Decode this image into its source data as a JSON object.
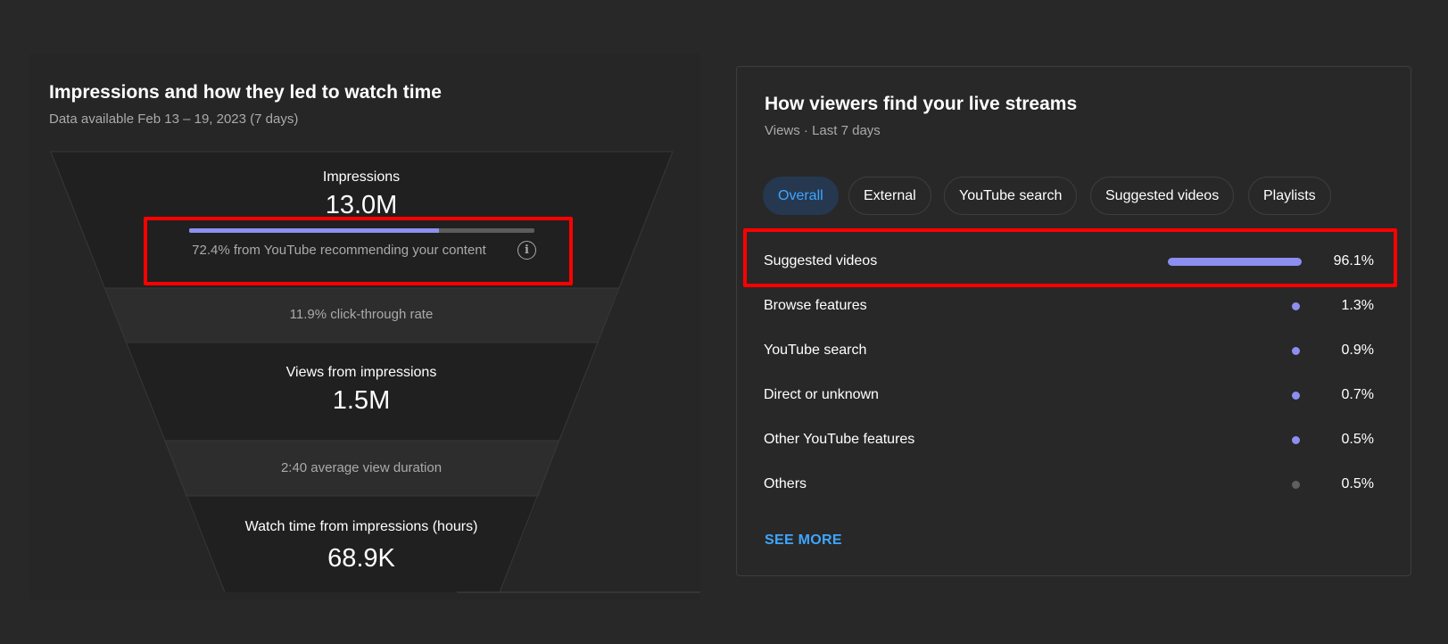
{
  "funnel_card": {
    "title": "Impressions and how they led to watch time",
    "subtitle": "Data available Feb 13 – 19, 2023 (7 days)",
    "impressions": {
      "label": "Impressions",
      "value": "13.0M",
      "recommend_text": "72.4% from YouTube recommending your content",
      "recommend_fraction": 0.724
    },
    "ctr_text": "11.9% click-through rate",
    "views": {
      "label": "Views from impressions",
      "value": "1.5M"
    },
    "avd_text": "2:40 average view duration",
    "watch_time": {
      "label": "Watch time from impressions (hours)",
      "value": "68.9K"
    }
  },
  "traffic_card": {
    "title": "How viewers find your live streams",
    "subtitle": "Views · Last 7 days",
    "chips": [
      {
        "label": "Overall",
        "active": true
      },
      {
        "label": "External",
        "active": false
      },
      {
        "label": "YouTube search",
        "active": false
      },
      {
        "label": "Suggested videos",
        "active": false
      },
      {
        "label": "Playlists",
        "active": false
      }
    ],
    "rows": [
      {
        "label": "Suggested videos",
        "value": "96.1%",
        "share": 0.961,
        "color": "#8c8ff0"
      },
      {
        "label": "Browse features",
        "value": "1.3%",
        "share": 0.013,
        "color": "#8c8ff0"
      },
      {
        "label": "YouTube search",
        "value": "0.9%",
        "share": 0.009,
        "color": "#8c8ff0"
      },
      {
        "label": "Direct or unknown",
        "value": "0.7%",
        "share": 0.007,
        "color": "#8c8ff0"
      },
      {
        "label": "Other YouTube features",
        "value": "0.5%",
        "share": 0.005,
        "color": "#8c8ff0"
      },
      {
        "label": "Others",
        "value": "0.5%",
        "share": 0.005,
        "color": "#5f5f5f"
      }
    ],
    "see_more": "SEE MORE"
  },
  "colors": {
    "accent": "#8c8ff0",
    "link": "#3ea6ff",
    "highlight": "#ff0000"
  }
}
